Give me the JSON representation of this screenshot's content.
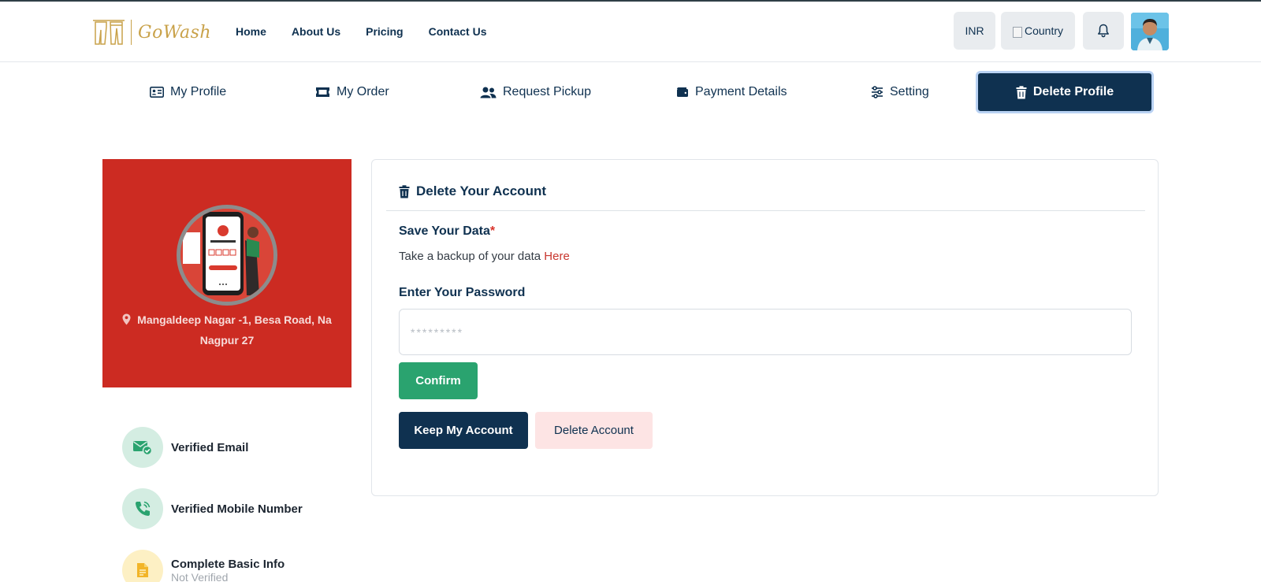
{
  "header": {
    "logo_text": "GoWash",
    "nav": [
      "Home",
      "About Us",
      "Pricing",
      "Contact Us"
    ],
    "currency": "INR",
    "country_alt": "Country",
    "bell_icon": "bell-icon",
    "avatar_icon": "user-avatar"
  },
  "tabs": [
    {
      "label": "My Profile",
      "icon": "id-card-icon"
    },
    {
      "label": "My Order",
      "icon": "ticket-icon"
    },
    {
      "label": "Request Pickup",
      "icon": "users-icon"
    },
    {
      "label": "Payment Details",
      "icon": "wallet-icon"
    },
    {
      "label": "Setting",
      "icon": "sliders-icon"
    },
    {
      "label": "Delete Profile",
      "icon": "trash-icon",
      "active": true
    }
  ],
  "profile": {
    "address": "Mangaldeep Nagar -1, Besa Road, Na Nagpur 27"
  },
  "verifications": [
    {
      "label": "Verified Email",
      "icon": "email-check-icon",
      "color": "#d4ede2"
    },
    {
      "label": "Verified Mobile Number",
      "icon": "phone-icon",
      "color": "#d4ede2"
    },
    {
      "label": "Complete Basic Info",
      "sub": "Not Verified",
      "icon": "document-icon",
      "color": "#fdf0c4"
    }
  ],
  "panel": {
    "title": "Delete Your Account",
    "save_title": "Save Your Data",
    "save_required": "*",
    "save_desc": "Take a backup of your data",
    "save_link": "Here",
    "password_label": "Enter Your Password",
    "password_placeholder": "*********",
    "confirm_label": "Confirm",
    "keep_label": "Keep My Account",
    "delete_label": "Delete Account"
  },
  "colors": {
    "primary": "#0f3150",
    "brand_gold": "#c9a24a",
    "profile_red": "#cc2b22",
    "confirm_green": "#2aa36f",
    "delete_pink": "#fde4e4"
  }
}
